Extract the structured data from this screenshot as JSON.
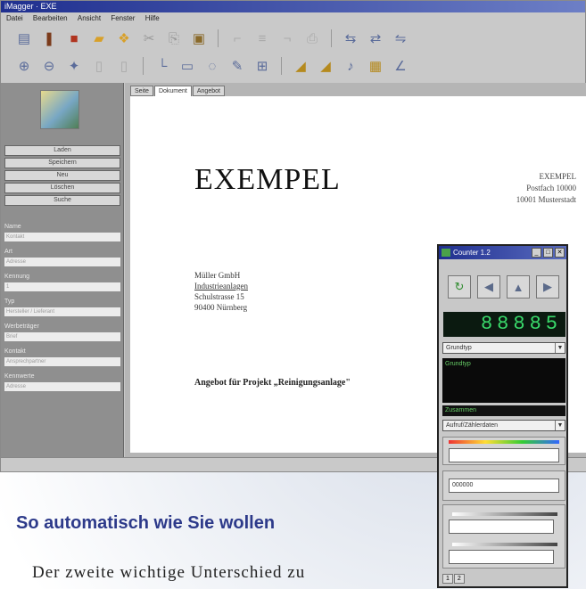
{
  "app": {
    "title": "iMagger · EXE",
    "menu": [
      "Datei",
      "Bearbeiten",
      "Ansicht",
      "Fenster",
      "Hilfe"
    ]
  },
  "toolbar1": [
    "page-icon",
    "paint-icon",
    "book-icon",
    "folder-icon",
    "open-icon",
    "cut-icon",
    "copy-icon",
    "paste-icon",
    "undo-icon",
    "redo-icon",
    "align-left-icon",
    "align-center-icon",
    "align-right-icon",
    "print-icon",
    "preview-icon",
    "export-icon"
  ],
  "toolbar2": [
    "zoom-in-icon",
    "zoom-out-icon",
    "grid-icon",
    "frame-icon",
    "text-icon",
    "line-icon",
    "rect-icon",
    "ellipse-icon",
    "image-icon",
    "table-icon",
    "chart-icon",
    "link-icon",
    "color-icon",
    "brush-icon"
  ],
  "sidebar": {
    "buttons": [
      "Laden",
      "Speichern",
      "Neu",
      "Löschen",
      "Suche"
    ],
    "fields": [
      {
        "label": "Name",
        "value": "Kontakt"
      },
      {
        "label": "Art",
        "value": "Adresse"
      },
      {
        "label": "Kennung",
        "value": "1"
      },
      {
        "label": "Typ",
        "value": "Hersteller / Lieferant"
      },
      {
        "label": "Werbeträger",
        "value": "Brief"
      },
      {
        "label": "Kontakt",
        "value": "Ansprechpartner"
      },
      {
        "label": "Kennwerte",
        "value": "Adresse"
      }
    ]
  },
  "doc_tabs": [
    "Seite",
    "Dokument",
    "Angebot"
  ],
  "document": {
    "logo": "EXEMPEL",
    "sender": [
      "EXEMPEL",
      "Postfach 10000",
      "10001 Musterstadt"
    ],
    "recipient": [
      "Müller GmbH",
      "Industrieanlagen",
      "Schulstrasse 15",
      "90400 Nürnberg"
    ],
    "subject": "Angebot für Projekt „Reinigungsanlage\""
  },
  "counter_panel": {
    "title": "Counter 1.2",
    "counter": "88885",
    "select": "Grundtyp",
    "list_text": "Grundtyp",
    "status": "Zusammen",
    "select2": "Aufruf/Zählerdaten",
    "color_field": "",
    "value_field": "000000",
    "bottom_tabs": [
      "1",
      "2"
    ]
  },
  "article": {
    "heading": "So automatisch wie Sie wollen",
    "body": "Der zweite wichtige Unterschied zu"
  }
}
